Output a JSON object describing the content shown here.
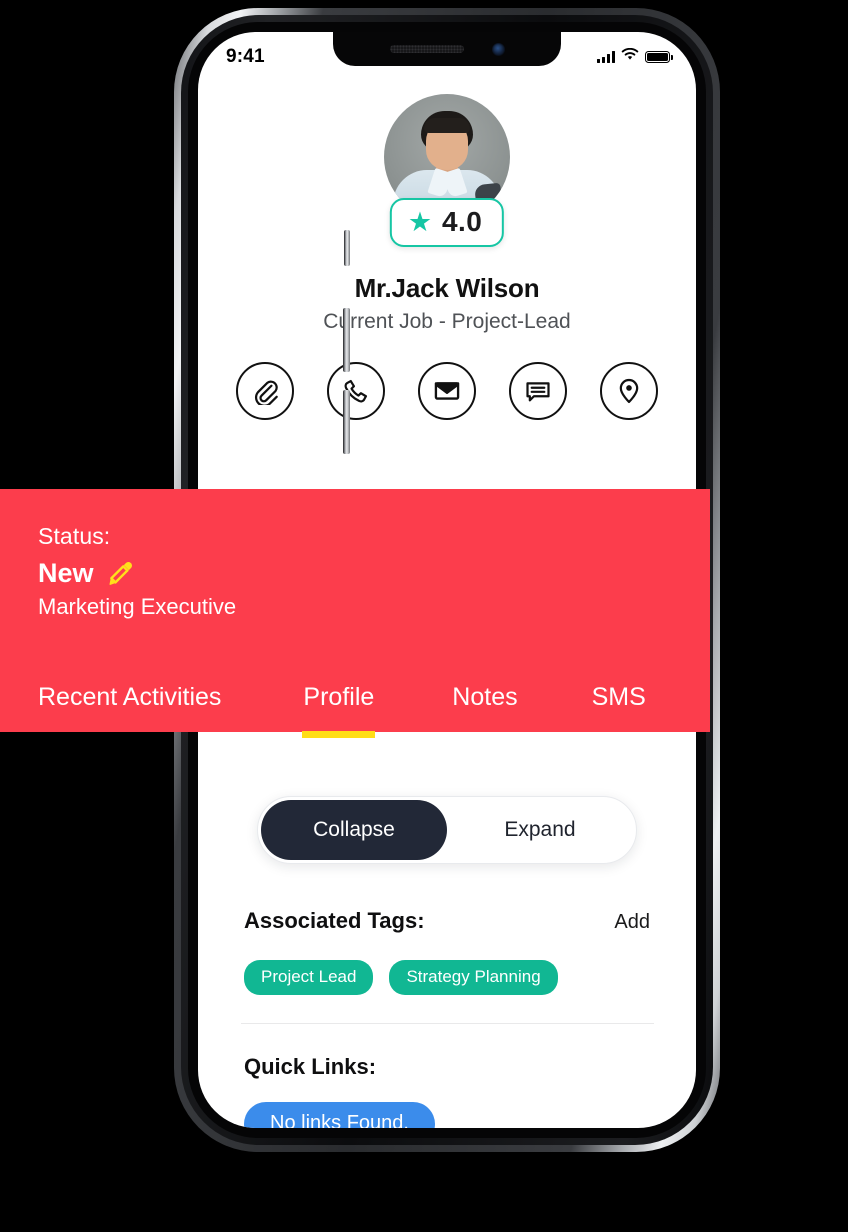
{
  "statusbar": {
    "time": "9:41",
    "signal_icon": "cellular-signal-icon",
    "wifi_icon": "wifi-icon",
    "battery_icon": "battery-icon"
  },
  "profile": {
    "avatar_alt": "avatar",
    "rating": {
      "star_icon": "star-icon",
      "value": "4.0",
      "border_color": "#16c6a4"
    },
    "name": "Mr.Jack Wilson",
    "job": "Current Job - Project-Lead"
  },
  "actions": [
    {
      "name": "attach-action",
      "icon": "paperclip-icon"
    },
    {
      "name": "call-action",
      "icon": "phone-icon"
    },
    {
      "name": "email-action",
      "icon": "envelope-icon"
    },
    {
      "name": "message-action",
      "icon": "chat-bubble-icon"
    },
    {
      "name": "location-action",
      "icon": "map-pin-icon"
    }
  ],
  "banner": {
    "background_color": "#fc3d4c",
    "status_label": "Status:",
    "status_value": "New",
    "edit_icon": "pencil-icon",
    "role": "Marketing Executive",
    "underline_color": "#ffde17",
    "tabs": [
      {
        "label": "Recent Activities",
        "active": false
      },
      {
        "label": "Profile",
        "active": true
      },
      {
        "label": "Notes",
        "active": false
      },
      {
        "label": "SMS",
        "active": false
      }
    ]
  },
  "segmented": {
    "collapse_label": "Collapse",
    "expand_label": "Expand",
    "active": "Collapse",
    "active_color": "#222837"
  },
  "tags_section": {
    "title": "Associated Tags:",
    "add_label": "Add",
    "tag_color": "#11b793",
    "tags": [
      "Project Lead",
      "Strategy Planning"
    ]
  },
  "quick_links_section": {
    "title": "Quick Links:",
    "empty_label": "No links Found.",
    "empty_color": "#3b8ceb"
  }
}
